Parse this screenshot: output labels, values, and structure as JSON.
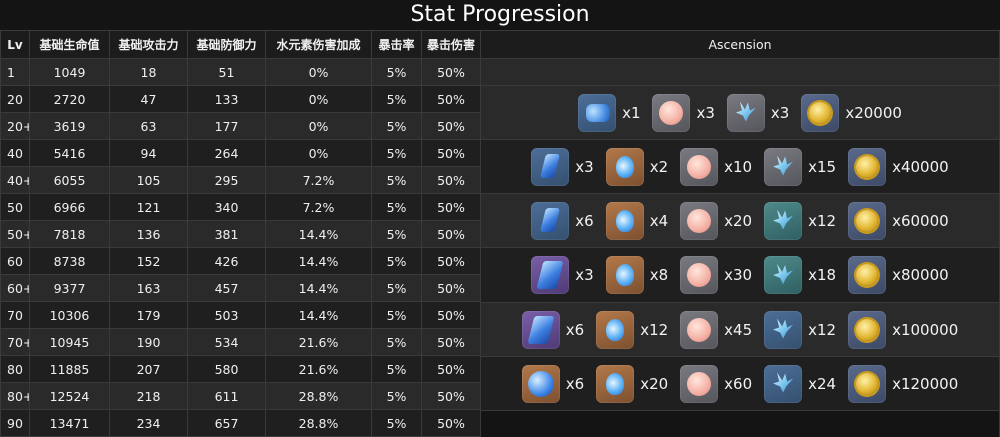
{
  "title": "Stat Progression",
  "table": {
    "headers": [
      "Lv",
      "基础生命值",
      "基础攻击力",
      "基础防御力",
      "水元素伤害加成",
      "暴击率",
      "暴击伤害"
    ],
    "rows": [
      [
        "1",
        "1049",
        "18",
        "51",
        "0%",
        "5%",
        "50%"
      ],
      [
        "20",
        "2720",
        "47",
        "133",
        "0%",
        "5%",
        "50%"
      ],
      [
        "20+",
        "3619",
        "63",
        "177",
        "0%",
        "5%",
        "50%"
      ],
      [
        "40",
        "5416",
        "94",
        "264",
        "0%",
        "5%",
        "50%"
      ],
      [
        "40+",
        "6055",
        "105",
        "295",
        "7.2%",
        "5%",
        "50%"
      ],
      [
        "50",
        "6966",
        "121",
        "340",
        "7.2%",
        "5%",
        "50%"
      ],
      [
        "50+",
        "7818",
        "136",
        "381",
        "14.4%",
        "5%",
        "50%"
      ],
      [
        "60",
        "8738",
        "152",
        "426",
        "14.4%",
        "5%",
        "50%"
      ],
      [
        "60+",
        "9377",
        "163",
        "457",
        "14.4%",
        "5%",
        "50%"
      ],
      [
        "70",
        "10306",
        "179",
        "503",
        "14.4%",
        "5%",
        "50%"
      ],
      [
        "70+",
        "10945",
        "190",
        "534",
        "21.6%",
        "5%",
        "50%"
      ],
      [
        "80",
        "11885",
        "207",
        "580",
        "21.6%",
        "5%",
        "50%"
      ],
      [
        "80+",
        "12524",
        "218",
        "611",
        "28.8%",
        "5%",
        "50%"
      ],
      [
        "90",
        "13471",
        "234",
        "657",
        "28.8%",
        "5%",
        "50%"
      ]
    ]
  },
  "ascension": {
    "header": "Ascension",
    "phases": [
      [
        {
          "icon": "hydro-sliver-icon",
          "qty": "x1"
        },
        {
          "icon": "pearl-icon",
          "qty": "x3"
        },
        {
          "icon": "shard-icon",
          "qty": "x3"
        },
        {
          "icon": "mora-coin-icon",
          "qty": "x20000"
        }
      ],
      [
        {
          "icon": "hydro-fragment-icon",
          "qty": "x3"
        },
        {
          "icon": "water-drop-icon",
          "qty": "x2"
        },
        {
          "icon": "pearl-icon",
          "qty": "x10"
        },
        {
          "icon": "shard-icon",
          "qty": "x15"
        },
        {
          "icon": "mora-coin-icon",
          "qty": "x40000"
        }
      ],
      [
        {
          "icon": "hydro-fragment-icon",
          "qty": "x6"
        },
        {
          "icon": "water-drop-icon",
          "qty": "x4"
        },
        {
          "icon": "pearl-icon",
          "qty": "x20"
        },
        {
          "icon": "crystal-shard-icon",
          "qty": "x12"
        },
        {
          "icon": "mora-coin-icon",
          "qty": "x60000"
        }
      ],
      [
        {
          "icon": "hydro-chunk-icon",
          "qty": "x3"
        },
        {
          "icon": "water-drop-icon",
          "qty": "x8"
        },
        {
          "icon": "pearl-icon",
          "qty": "x30"
        },
        {
          "icon": "crystal-shard-icon",
          "qty": "x18"
        },
        {
          "icon": "mora-coin-icon",
          "qty": "x80000"
        }
      ],
      [
        {
          "icon": "hydro-chunk-icon",
          "qty": "x6"
        },
        {
          "icon": "water-drop-icon",
          "qty": "x12"
        },
        {
          "icon": "pearl-icon",
          "qty": "x45"
        },
        {
          "icon": "prism-shard-icon",
          "qty": "x12"
        },
        {
          "icon": "mora-coin-icon",
          "qty": "x100000"
        }
      ],
      [
        {
          "icon": "hydro-gemstone-icon",
          "qty": "x6"
        },
        {
          "icon": "water-drop-icon",
          "qty": "x20"
        },
        {
          "icon": "pearl-icon",
          "qty": "x60"
        },
        {
          "icon": "prism-shard-icon",
          "qty": "x24"
        },
        {
          "icon": "mora-coin-icon",
          "qty": "x120000"
        }
      ]
    ]
  }
}
